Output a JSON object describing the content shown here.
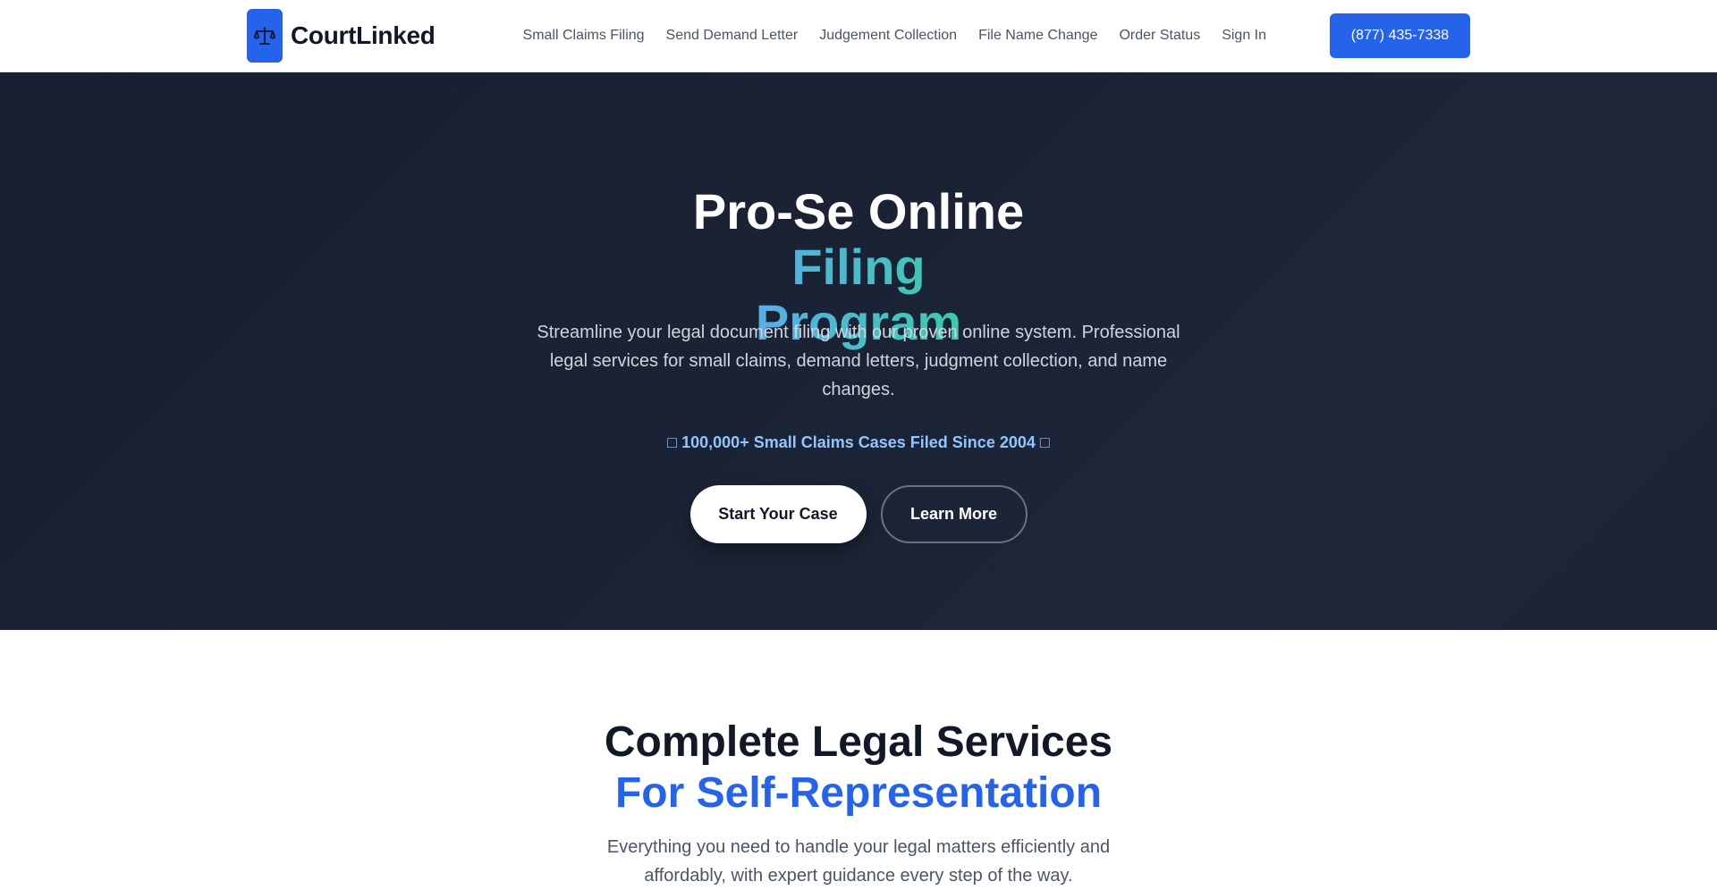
{
  "header": {
    "brand": "CourtLinked",
    "nav": [
      {
        "label": "Small Claims Filing"
      },
      {
        "label": "Send Demand Letter"
      },
      {
        "label": "Judgement Collection"
      },
      {
        "label": "File Name Change"
      },
      {
        "label": "Order Status"
      },
      {
        "label": "Sign In"
      }
    ],
    "phone_label": "(877) 435-7338"
  },
  "hero": {
    "title_line1": "Pro-Se Online",
    "title_line2": "Filing Program",
    "subtitle": "Streamline your legal document filing with our proven online system. Professional legal services for small claims, demand letters, judgment collection, and name changes.",
    "stat": "□ 100,000+ Small Claims Cases Filed Since 2004 □",
    "primary_button": "Start Your Case",
    "secondary_button": "Learn More"
  },
  "services": {
    "title_line1": "Complete Legal Services",
    "title_line2": "For Self-Representation",
    "subtitle": "Everything you need to handle your legal matters efficiently and affordably, with expert guidance every step of the way."
  },
  "icons": {
    "logo": "scales-of-justice-icon"
  },
  "colors": {
    "accent": "#2563eb",
    "hero_bg": "#1a2234",
    "gradient_start": "#60a5fa",
    "gradient_end": "#34d399",
    "stat_text": "#93c5fd"
  }
}
